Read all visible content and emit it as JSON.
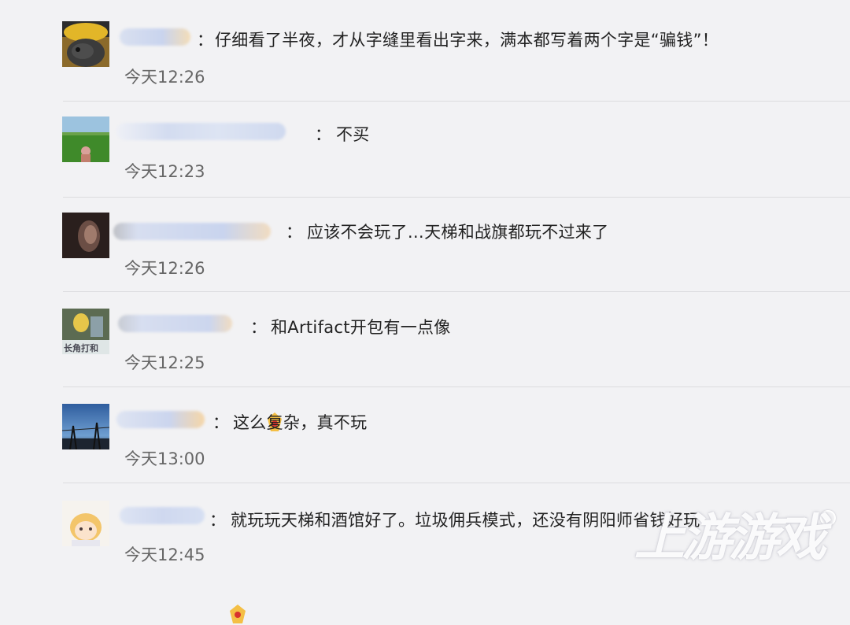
{
  "comments": [
    {
      "separator": "：",
      "text": "仔细看了半夜，才从字缝里看出字来，满本都写着两个字是“骗钱”！",
      "time": "今天12:26"
    },
    {
      "separator": "：",
      "text": "不买",
      "time": "今天12:23"
    },
    {
      "separator": "：",
      "text": "应该不会玩了…天梯和战旗都玩不过来了",
      "time": "今天12:26"
    },
    {
      "separator": "：",
      "text": "和Artifact开包有一点像",
      "time": "今天12:25"
    },
    {
      "separator": "：",
      "text": "这么复杂，真不玩",
      "time": "今天13:00"
    },
    {
      "separator": "：",
      "text": "就玩玩天梯和酒馆好了。垃圾佣兵模式，还没有阴阳师省钱好玩",
      "time": "今天12:45"
    }
  ],
  "avatar_captions": {
    "c4": "长角打和"
  },
  "watermark": "上游游戏",
  "colors": {
    "background": "#f2f2f4",
    "text": "#222222",
    "time": "#666666",
    "divider": "#dcdcdf"
  }
}
